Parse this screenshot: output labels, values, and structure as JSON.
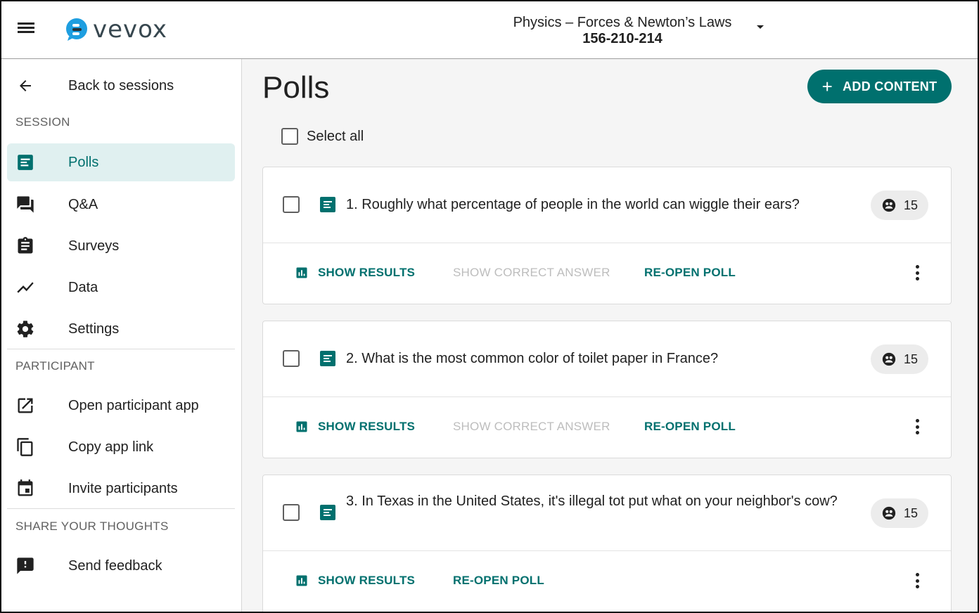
{
  "app": {
    "brand": "vevox",
    "session_title": "Physics – Forces & Newton’s Laws",
    "session_code": "156-210-214",
    "accent_color": "#00706e"
  },
  "sidebar": {
    "back_label": "Back to sessions",
    "session_heading": "SESSION",
    "session_items": [
      {
        "label": "Polls",
        "icon": "poll-icon",
        "active": true
      },
      {
        "label": "Q&A",
        "icon": "forum-icon"
      },
      {
        "label": "Surveys",
        "icon": "clipboard-icon"
      },
      {
        "label": "Data",
        "icon": "trend-line-icon"
      },
      {
        "label": "Settings",
        "icon": "gear-icon"
      }
    ],
    "participant_heading": "PARTICIPANT",
    "participant_items": [
      {
        "label": "Open participant app",
        "icon": "open-external-icon"
      },
      {
        "label": "Copy app link",
        "icon": "copy-icon"
      },
      {
        "label": "Invite participants",
        "icon": "calendar-icon"
      }
    ],
    "thoughts_heading": "SHARE YOUR THOUGHTS",
    "thoughts_items": [
      {
        "label": "Send feedback",
        "icon": "feedback-icon"
      }
    ]
  },
  "main": {
    "title": "Polls",
    "add_button": "ADD CONTENT",
    "select_all": "Select all",
    "polls": [
      {
        "question": "1. Roughly what percentage of people in the world can wiggle their ears?",
        "responses": "15",
        "actions": [
          "SHOW RESULTS",
          "SHOW CORRECT ANSWER",
          "RE-OPEN POLL"
        ]
      },
      {
        "question": "2. What is the most common color of toilet paper in France?",
        "responses": "15",
        "actions": [
          "SHOW RESULTS",
          "SHOW CORRECT ANSWER",
          "RE-OPEN POLL"
        ]
      },
      {
        "question": "3. In Texas in the United States, it's illegal tot put what on your neighbor's cow?",
        "responses": "15",
        "actions": [
          "SHOW RESULTS",
          "RE-OPEN POLL"
        ]
      }
    ]
  }
}
